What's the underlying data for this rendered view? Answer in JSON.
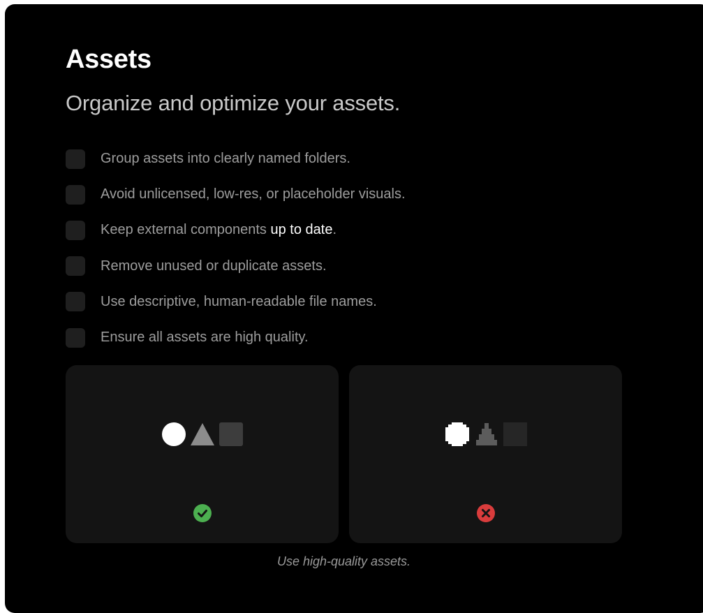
{
  "header": {
    "title": "Assets",
    "subtitle": "Organize and optimize your assets."
  },
  "checklist": {
    "items": [
      {
        "text": "Group assets into clearly named folders.",
        "checked": false
      },
      {
        "text": "Avoid unlicensed, low-res, or placeholder visuals.",
        "checked": false
      },
      {
        "text_before": "Keep external components ",
        "text_highlight": "up to date",
        "text_after": ".",
        "checked": false
      },
      {
        "text": "Remove unused or duplicate assets.",
        "checked": false
      },
      {
        "text": "Use descriptive, human-readable file names.",
        "checked": false
      },
      {
        "text": "Ensure all assets are high quality.",
        "checked": false
      }
    ]
  },
  "examples": {
    "good": {
      "shapes": [
        "circle-icon",
        "triangle-icon",
        "square-icon"
      ],
      "status_icon": "check-circle-icon",
      "status_color": "#4caf50"
    },
    "bad": {
      "shapes": [
        "pixelated-circle-icon",
        "pixelated-triangle-icon",
        "pixelated-square-icon"
      ],
      "status_icon": "x-circle-icon",
      "status_color": "#d93c3c"
    },
    "caption": "Use high-quality assets."
  },
  "colors": {
    "panel_background": "#000000",
    "card_background": "#141414",
    "checkbox_background": "#1f1f1f",
    "text_primary": "#ffffff",
    "text_secondary": "#9d9d9d"
  }
}
